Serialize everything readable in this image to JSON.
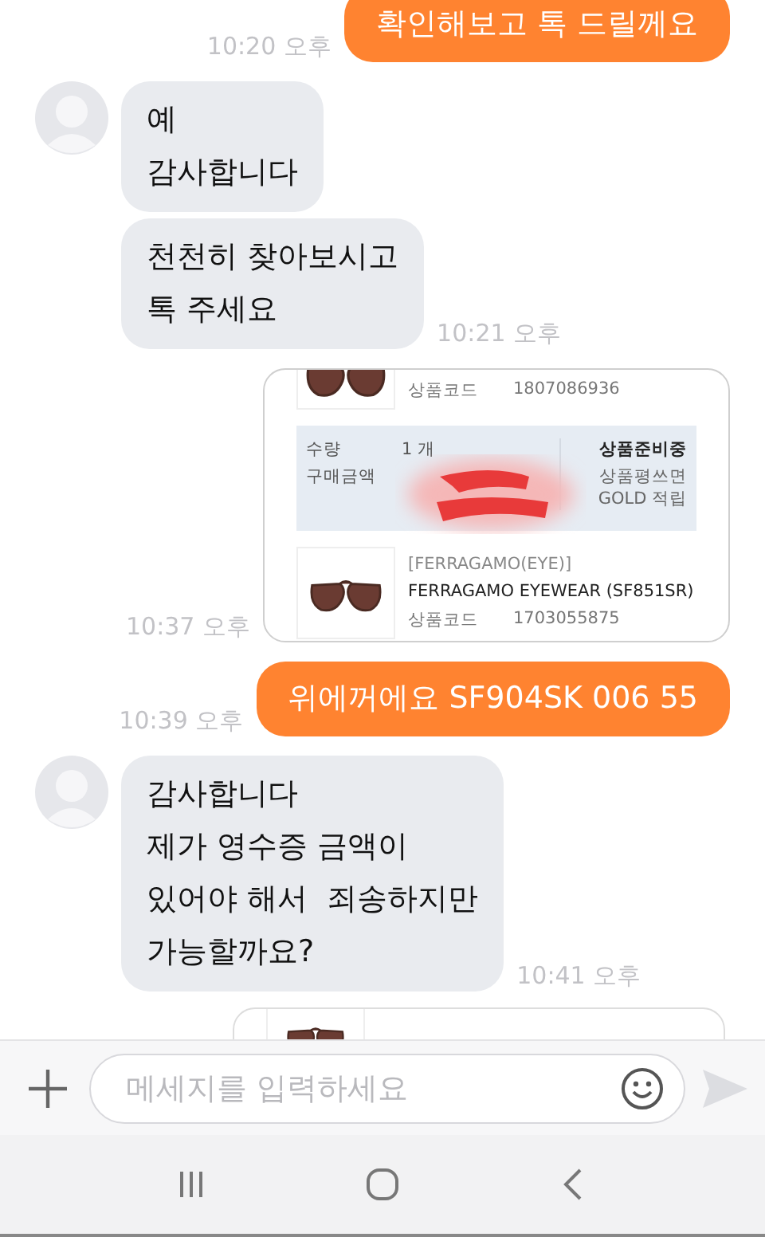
{
  "messages": [
    {
      "kind": "sent-text",
      "text": "확인해보고 톡 드릴께요",
      "time": "10:20 오후"
    },
    {
      "kind": "received-text",
      "avatar": true,
      "text": "예\n감사합니다"
    },
    {
      "kind": "received-text",
      "avatar": false,
      "text": "천천히 찾아보시고\n톡 주세요",
      "time": "10:21 오후"
    },
    {
      "kind": "sent-card",
      "time": "10:37 오후",
      "card": {
        "top_code_label": "상품코드",
        "top_code": "1807086936",
        "qty_label": "수량",
        "qty": "1 개",
        "amount_label": "구매금액",
        "redacted": true,
        "status": "상품준비중",
        "note": "상품평쓰면\nGOLD 적립",
        "brand": "[FERRAGAMO(EYE)]",
        "product": "FERRAGAMO EYEWEAR (SF851SR)",
        "code_label": "상품코드",
        "code": "1703055875"
      }
    },
    {
      "kind": "sent-text",
      "text": "위에꺼에요 SF904SK 006 55",
      "time": "10:39 오후"
    },
    {
      "kind": "received-text",
      "avatar": true,
      "text": "감사합니다\n제가 영수증 금액이\n있어야 해서  죄송하지만\n가능할까요?",
      "time": "10:41 오후"
    },
    {
      "kind": "sent-card-peek"
    }
  ],
  "composer": {
    "placeholder": "메세지를 입력하세요"
  }
}
